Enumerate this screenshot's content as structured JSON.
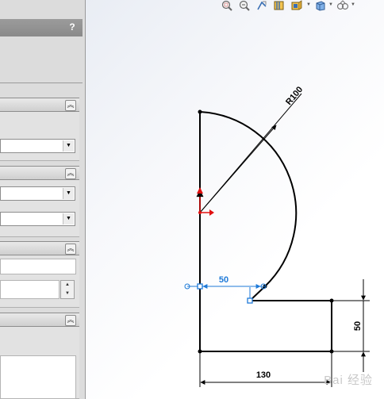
{
  "panel": {
    "help_label": "?"
  },
  "sketch": {
    "radius_dim": "R100",
    "horizontal_dim": "50",
    "vertical_dim": "50",
    "bottom_dim": "130"
  },
  "toolbar": {
    "icons": [
      "zoom-to-fit-icon",
      "zoom-area-icon",
      "previous-view-icon",
      "section-view-icon",
      "view-orientation-icon",
      "display-style-icon",
      "hide-show-icon"
    ]
  },
  "watermark": {
    "text": "Bai 经验"
  },
  "colors": {
    "dimension_blue": "#1e7ad8",
    "sketch_black": "#000000",
    "origin_red": "#e01010"
  }
}
